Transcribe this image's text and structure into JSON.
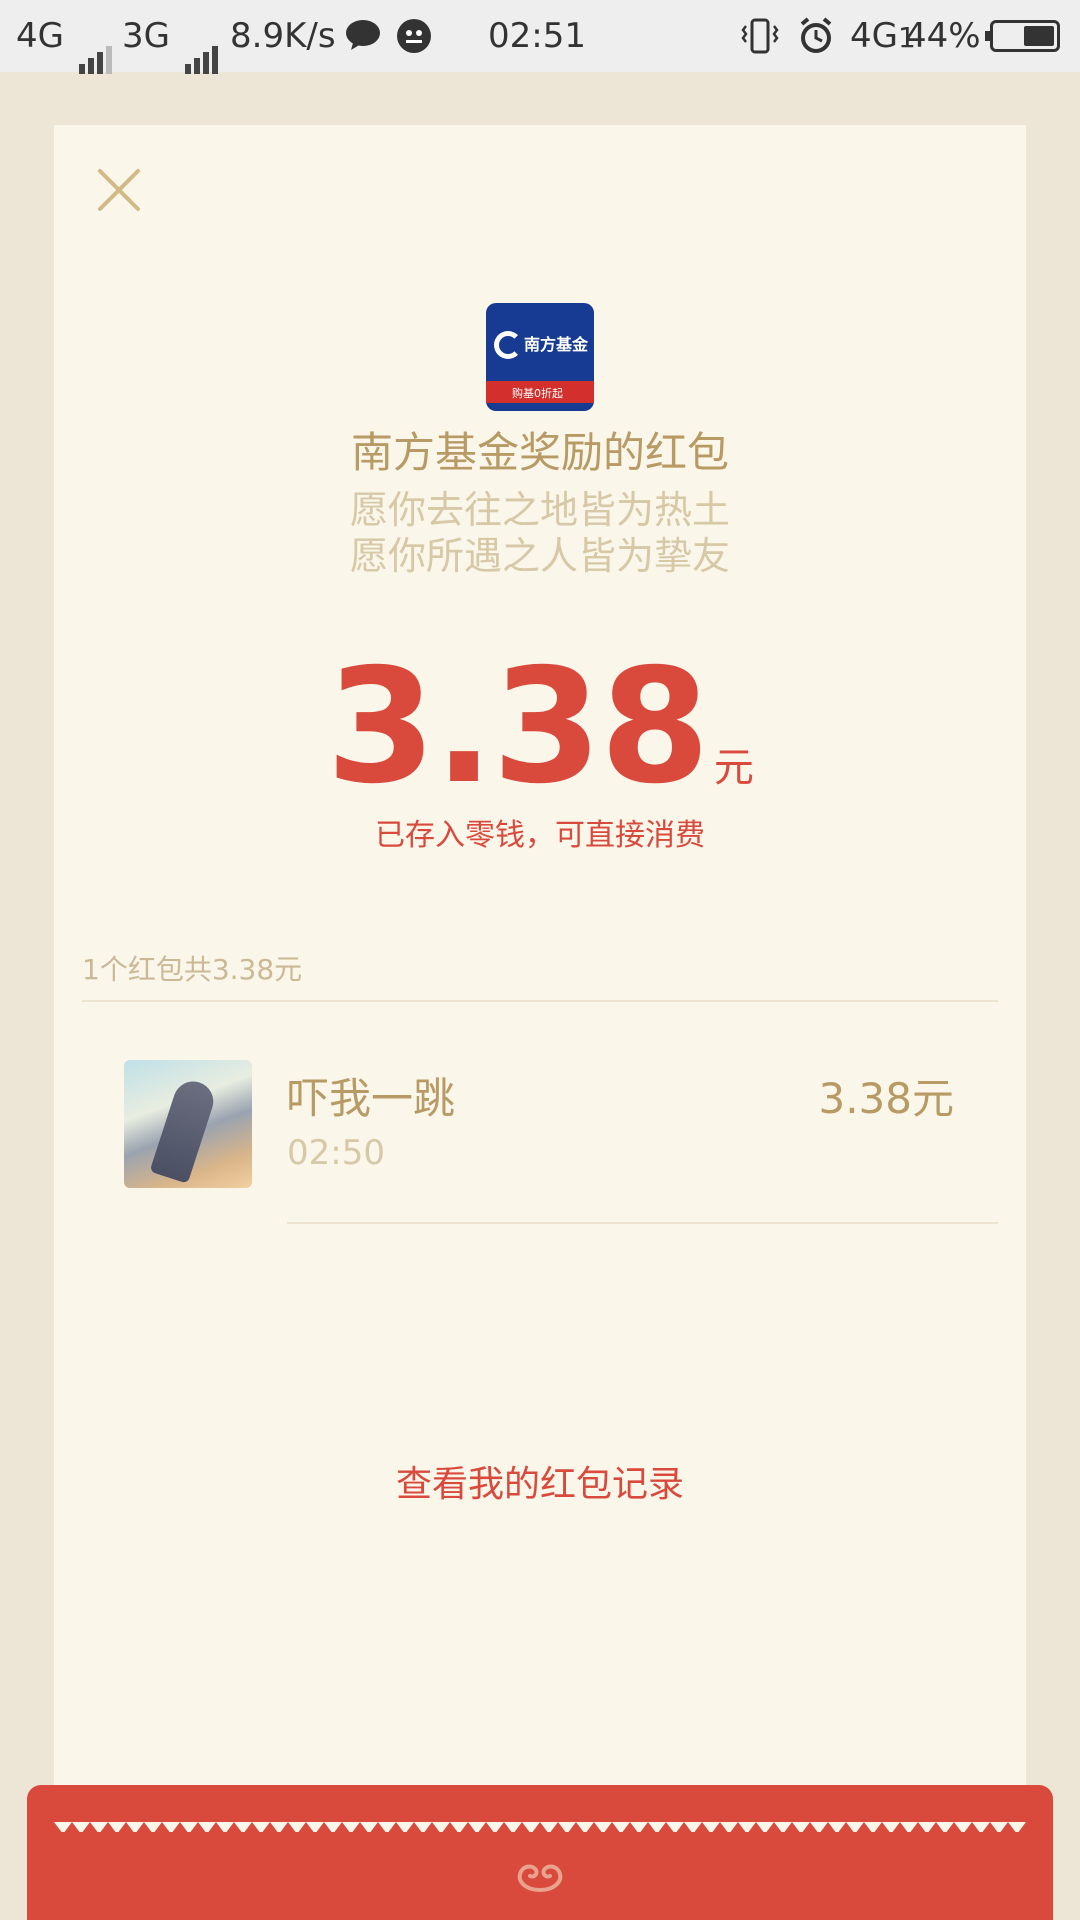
{
  "status_bar": {
    "network1": "4G",
    "network2": "3G",
    "speed": "8.9K/s",
    "time": "02:51",
    "network3": "4G",
    "network3_sub": "1",
    "battery": "44%",
    "icons": [
      "signal-icon",
      "chat-bubble-icon",
      "qq-icon",
      "vibrate-icon",
      "alarm-icon",
      "battery-icon"
    ]
  },
  "header": {
    "close_icon": "close-icon",
    "logo": {
      "brand": "南方基金",
      "slogan": "购基0折起"
    },
    "title": "南方基金奖励的红包",
    "blessing_line1": "愿你去往之地皆为热土",
    "blessing_line2": "愿你所遇之人皆为挚友"
  },
  "amount": {
    "value": "3.38",
    "unit": "元",
    "note": "已存入零钱，可直接消费"
  },
  "summary": "1个红包共3.38元",
  "receivers": [
    {
      "name": "吓我一跳",
      "time": "02:50",
      "amount": "3.38元"
    }
  ],
  "record_link": "查看我的红包记录",
  "colors": {
    "accent_red": "#d94a3d",
    "gold_text": "#b89a64",
    "light_gold": "#d7c8a6",
    "card_bg": "#faf6ea",
    "page_bg": "#ede6d6"
  }
}
